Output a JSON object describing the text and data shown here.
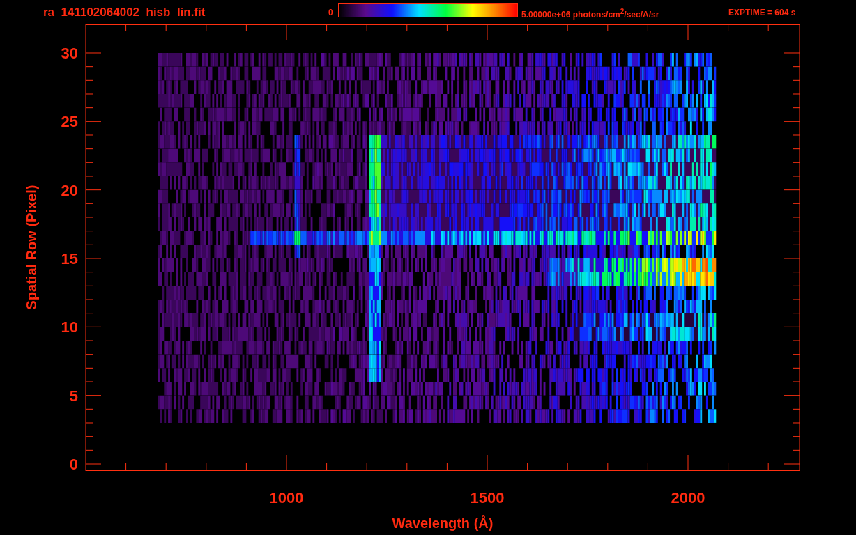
{
  "header": {
    "file_name": "ra_141102064002_hisb_lin.fit",
    "colorbar_min": "0",
    "colorbar_max": "5.00000e+06 photons/cm$^{2}$/sec/A/sr",
    "exposure": "EXPTIME = 604 s"
  },
  "plot": {
    "y_label": "Spatial Row (Pixel)",
    "x_label": "Wavelength (Å)",
    "y_ticks": [
      "30",
      "25",
      "20",
      "15",
      "10",
      "5",
      "0"
    ],
    "x_ticks": [
      "1000",
      "1500",
      "2000"
    ]
  }
}
